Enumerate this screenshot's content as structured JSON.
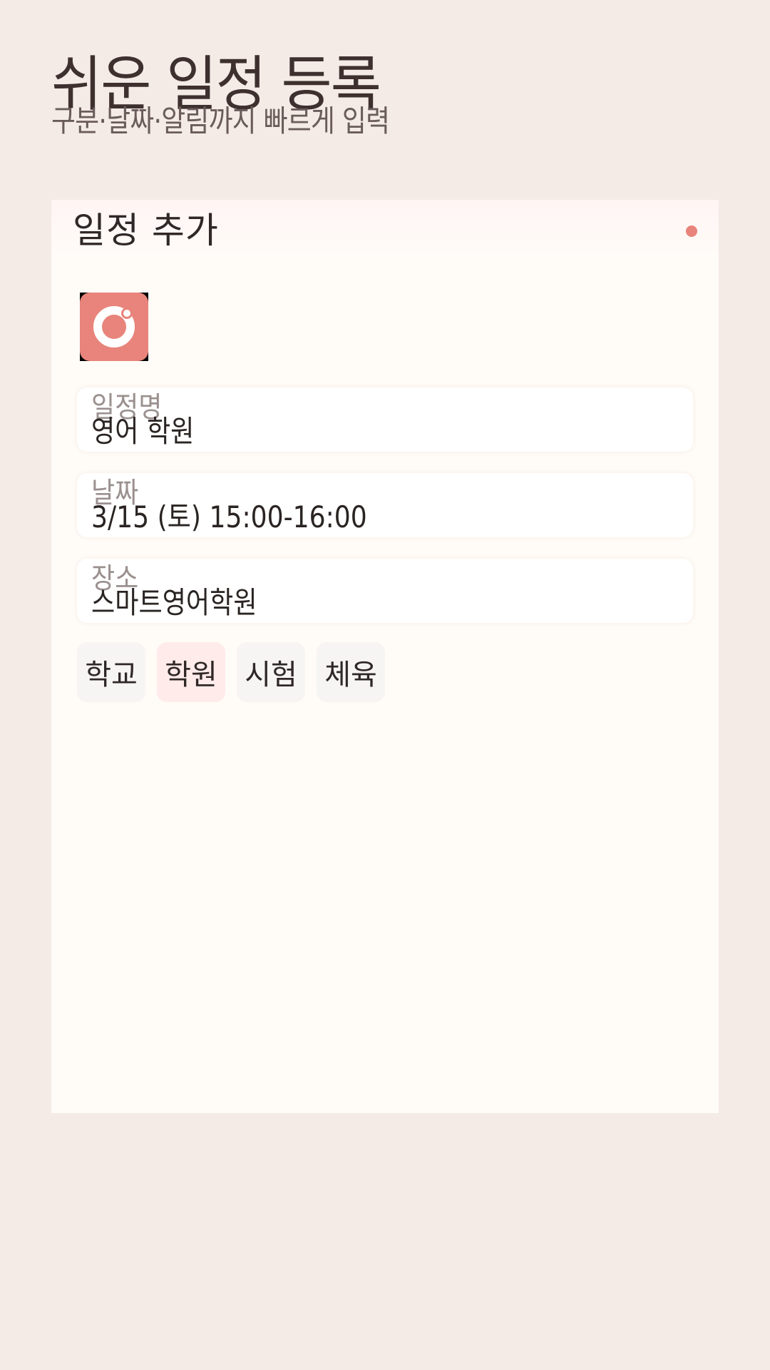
{
  "header": {
    "title": "쉬운 일정 등록",
    "subtitle": "구분·날짜·알림까지 빠르게 입력"
  },
  "card": {
    "title": "일정 추가",
    "status_dot_color": "#e8847b",
    "app_icon": "app-ring-icon",
    "fields": [
      {
        "label": "일정명",
        "value": "영어 학원"
      },
      {
        "label": "날짜",
        "value": "3/15 (토) 15:00-16:00"
      },
      {
        "label": "장소",
        "value": "스마트영어학원"
      }
    ],
    "categories": [
      {
        "label": "학교",
        "selected": false
      },
      {
        "label": "학원",
        "selected": true
      },
      {
        "label": "시험",
        "selected": false
      },
      {
        "label": "체육",
        "selected": false
      }
    ]
  },
  "colors": {
    "background": "#f4ebe7",
    "card": "#fffcf8",
    "accent": "#e8847b",
    "chip_selected": "#ffebea"
  }
}
